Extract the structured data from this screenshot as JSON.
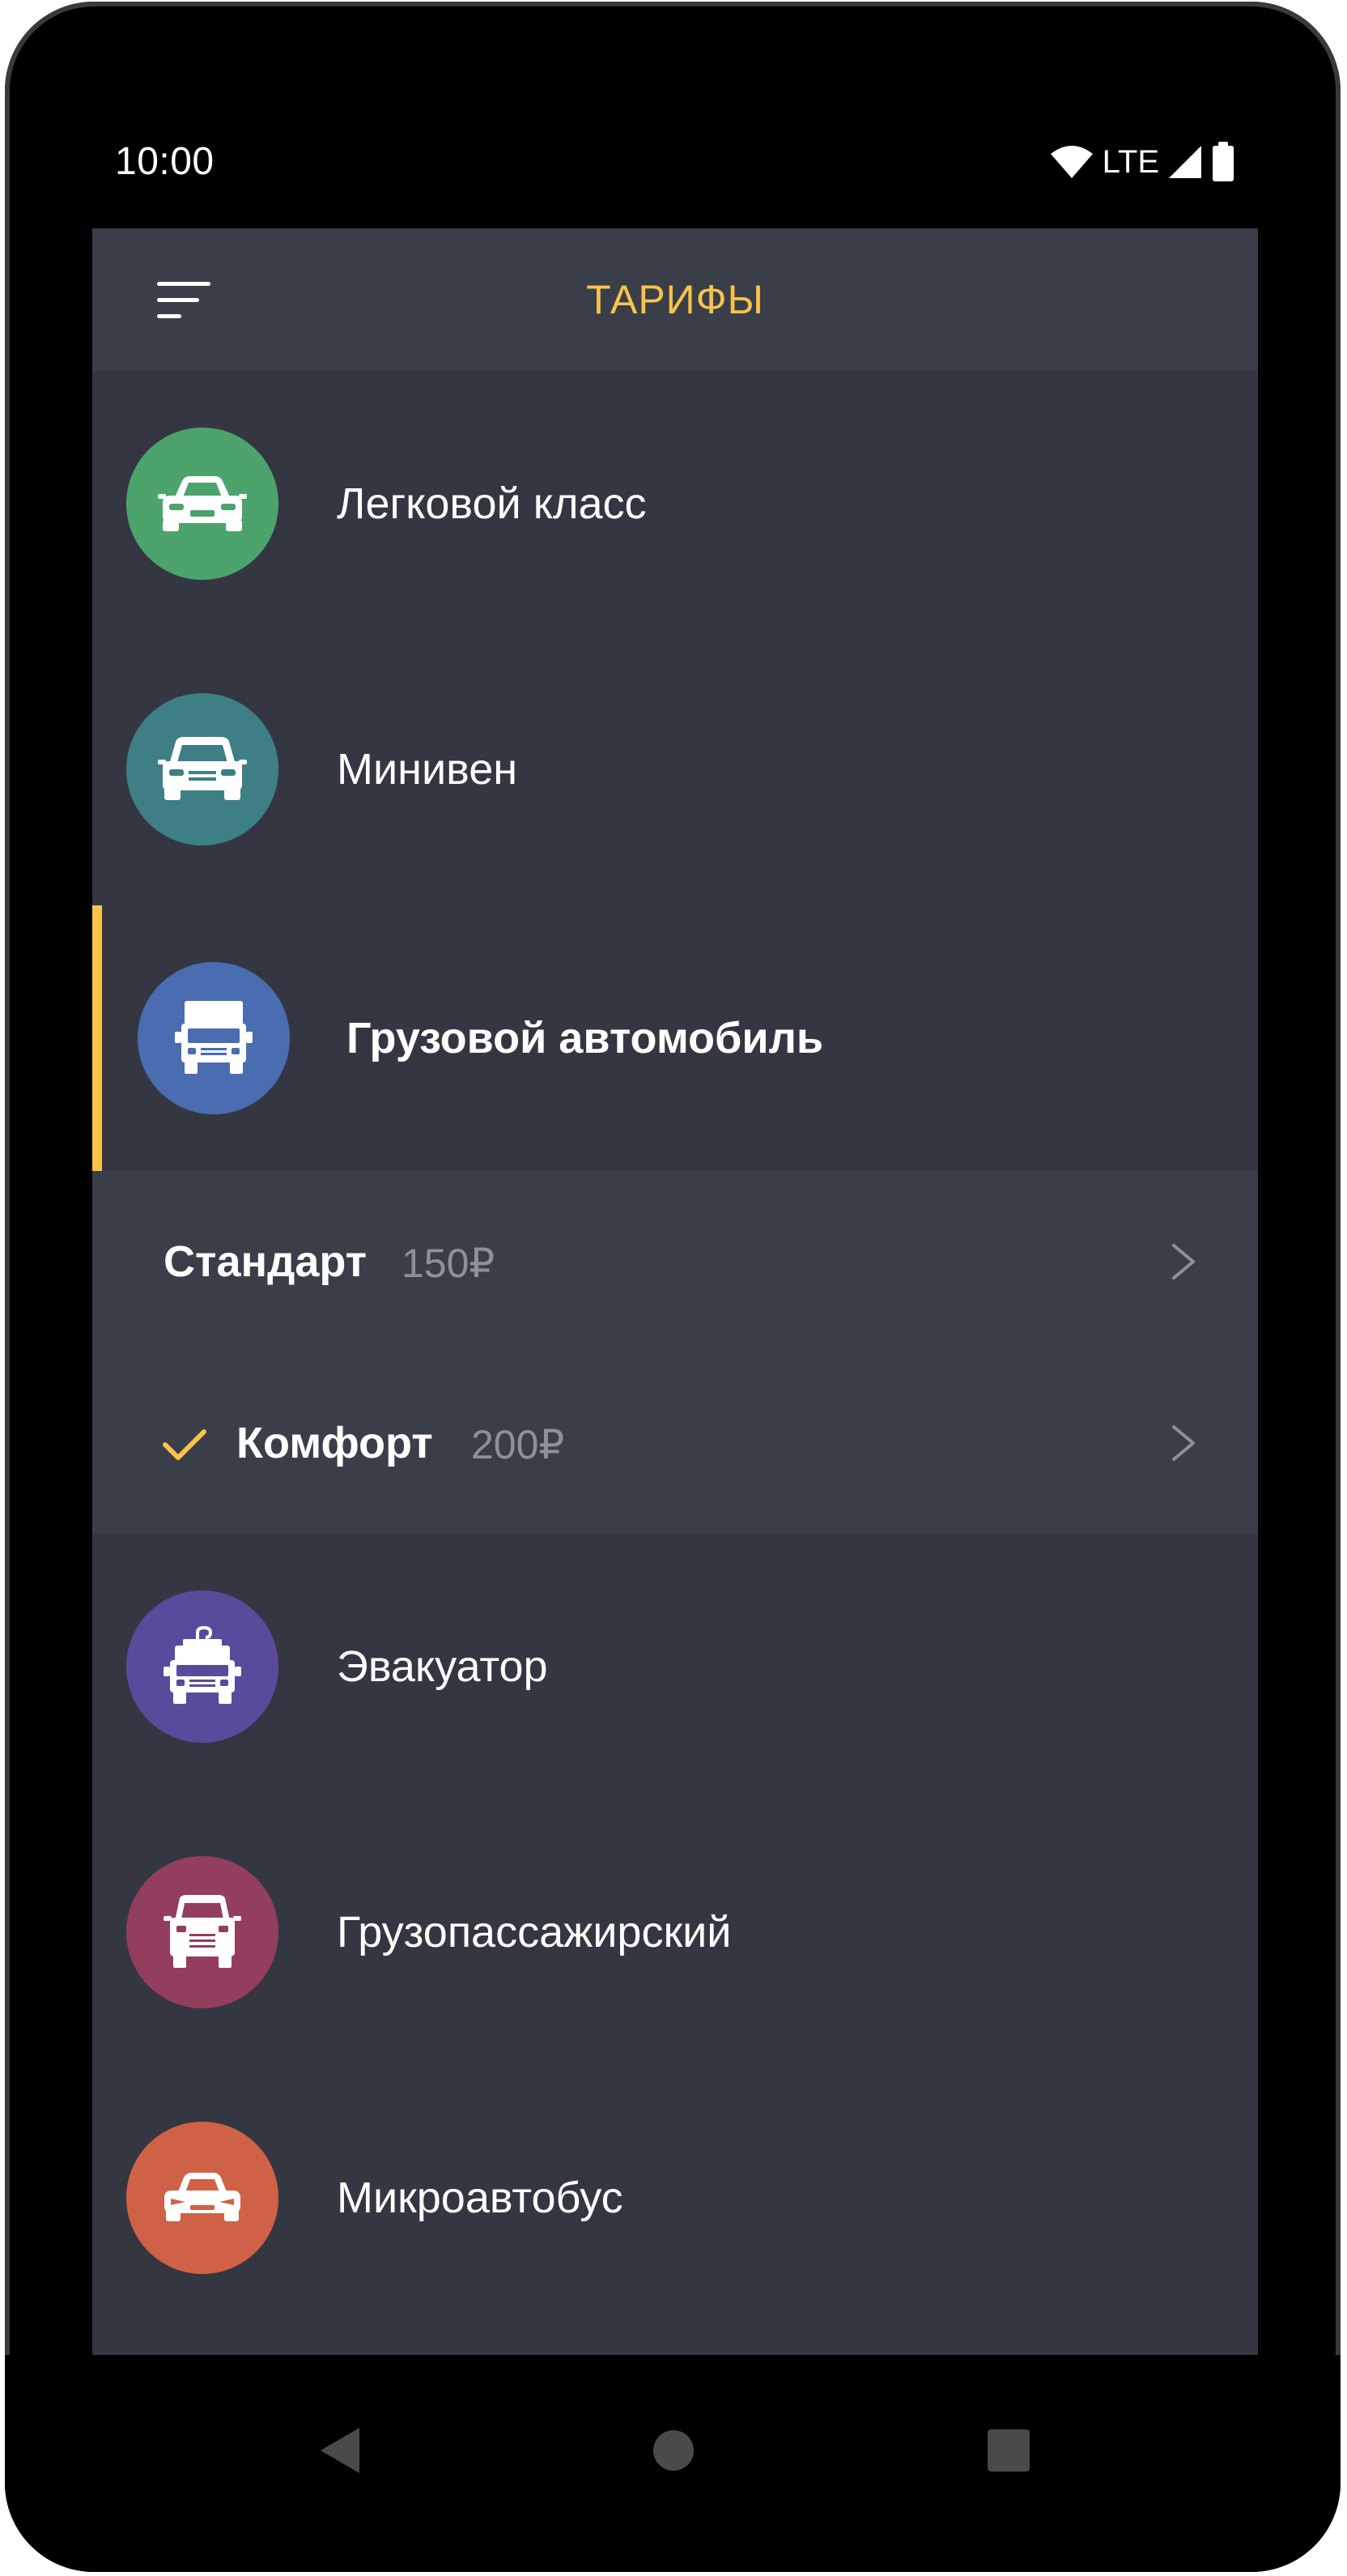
{
  "status_bar": {
    "time": "10:00",
    "network": "LTE",
    "icons": [
      "wifi-icon",
      "cell-signal-icon",
      "battery-icon"
    ]
  },
  "app_bar": {
    "title": "ТАРИФЫ",
    "menu_icon": "menu-icon"
  },
  "colors": {
    "background": "#343741",
    "app_bar": "#3a3e48",
    "accent": "#f8c34a",
    "price_text": "#8d919c"
  },
  "tariffs": [
    {
      "label": "Легковой класс",
      "icon": "sedan-car-icon",
      "color": "#4da36c"
    },
    {
      "label": "Минивен",
      "icon": "minivan-icon",
      "color": "#3e7f86"
    },
    {
      "label": "Грузовой автомобиль",
      "icon": "truck-icon",
      "color": "#4a6cb0",
      "expanded": true,
      "options": [
        {
          "name": "Стандарт",
          "price": "150₽",
          "selected": false
        },
        {
          "name": "Комфорт",
          "price": "200₽",
          "selected": true
        }
      ]
    },
    {
      "label": "Эвакуатор",
      "icon": "tow-truck-icon",
      "color": "#5a4a9c"
    },
    {
      "label": "Грузопассажирский",
      "icon": "cargo-van-icon",
      "color": "#933e5f"
    },
    {
      "label": "Микроавтобус",
      "icon": "minibus-icon",
      "color": "#cf6246"
    }
  ],
  "nav_bar": {
    "buttons": [
      "back-icon",
      "home-icon",
      "recents-icon"
    ]
  }
}
